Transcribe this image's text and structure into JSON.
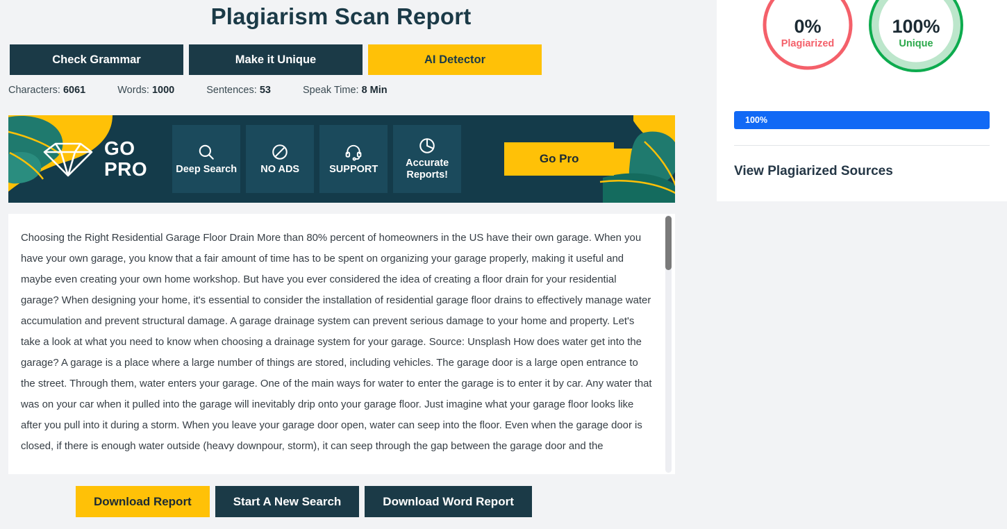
{
  "header": {
    "title": "Plagiarism Scan Report"
  },
  "action_tabs": [
    {
      "label": "Check Grammar",
      "style": "dark",
      "name": "check-grammar"
    },
    {
      "label": "Make it Unique",
      "style": "dark",
      "name": "make-it-unique"
    },
    {
      "label": "AI Detector",
      "style": "accent",
      "name": "ai-detector"
    }
  ],
  "stats": [
    {
      "key": "Characters:",
      "value": "6061"
    },
    {
      "key": "Words:",
      "value": "1000"
    },
    {
      "key": "Sentences:",
      "value": "53"
    },
    {
      "key": "Speak Time:",
      "value": "8 Min"
    }
  ],
  "gopro": {
    "logo_line1": "GO",
    "logo_line2": "PRO",
    "logo_icon": "diamond-icon",
    "features": [
      {
        "icon": "search-icon",
        "label": "Deep Search"
      },
      {
        "icon": "no-ads-icon",
        "label": "NO ADS"
      },
      {
        "icon": "headset-icon",
        "label": "SUPPORT"
      },
      {
        "icon": "pie-chart-icon",
        "label": "Accurate Reports!"
      }
    ],
    "cta_label": "Go Pro",
    "colors": {
      "background": "#143b4a",
      "tile": "#1b4a5c",
      "accent": "#ffc107",
      "leaf": "#1f7a6e"
    }
  },
  "document": {
    "text": "Choosing the Right Residential Garage Floor Drain More than 80% percent of homeowners in the US have their own garage. When you have your own garage, you know that a fair amount of time has to be spent on organizing your garage properly, making it useful and maybe even creating your own home workshop. But have you ever considered the idea of creating a floor drain for your residential garage? When designing your home, it's essential to consider the installation of residential garage floor drains to effectively manage water accumulation and prevent structural damage. A garage drainage system can prevent serious damage to your home and property. Let's take a look at what you need to know when choosing a drainage system for your garage. Source: Unsplash How does water get into the garage? A garage is a place where a large number of things are stored, including vehicles. The garage door is a large open entrance to the street. Through them, water enters your garage. One of the main ways for water to enter the garage is to enter it by car. Any water that was on your car when it pulled into the garage will inevitably drip onto your garage floor. Just imagine what your garage floor looks like after you pull into it during a storm. When you leave your garage door open, water can seep into the floor. Even when the garage door is closed, if there is enough water outside (heavy downpour, storm), it can seep through the gap between the garage door and the"
  },
  "bottom_buttons": [
    {
      "label": "Download Report",
      "style": "accent",
      "name": "download-report"
    },
    {
      "label": "Start A New Search",
      "style": "dark",
      "name": "start-a-new-search"
    },
    {
      "label": "Download Word Report",
      "style": "dark",
      "name": "download-word-report"
    }
  ],
  "sidebar": {
    "gauges": [
      {
        "value": "0%",
        "caption": "Plagiarized",
        "percent": 0,
        "color": "#f4606a",
        "track": "#ffffff"
      },
      {
        "value": "100%",
        "caption": "Unique",
        "percent": 100,
        "color": "#0dab4e",
        "track": "#bce6cb"
      }
    ],
    "progress": {
      "label": "100%",
      "percent": 100,
      "color": "#1169f5"
    },
    "sources_link": "View Plagiarized Sources"
  },
  "chart_data": {
    "type": "pie",
    "title": "Plagiarism Scan Result",
    "categories": [
      "Plagiarized",
      "Unique"
    ],
    "values": [
      0,
      100
    ],
    "unit": "%",
    "colors": [
      "#f4606a",
      "#0dab4e"
    ],
    "legend": "inside-donut"
  }
}
